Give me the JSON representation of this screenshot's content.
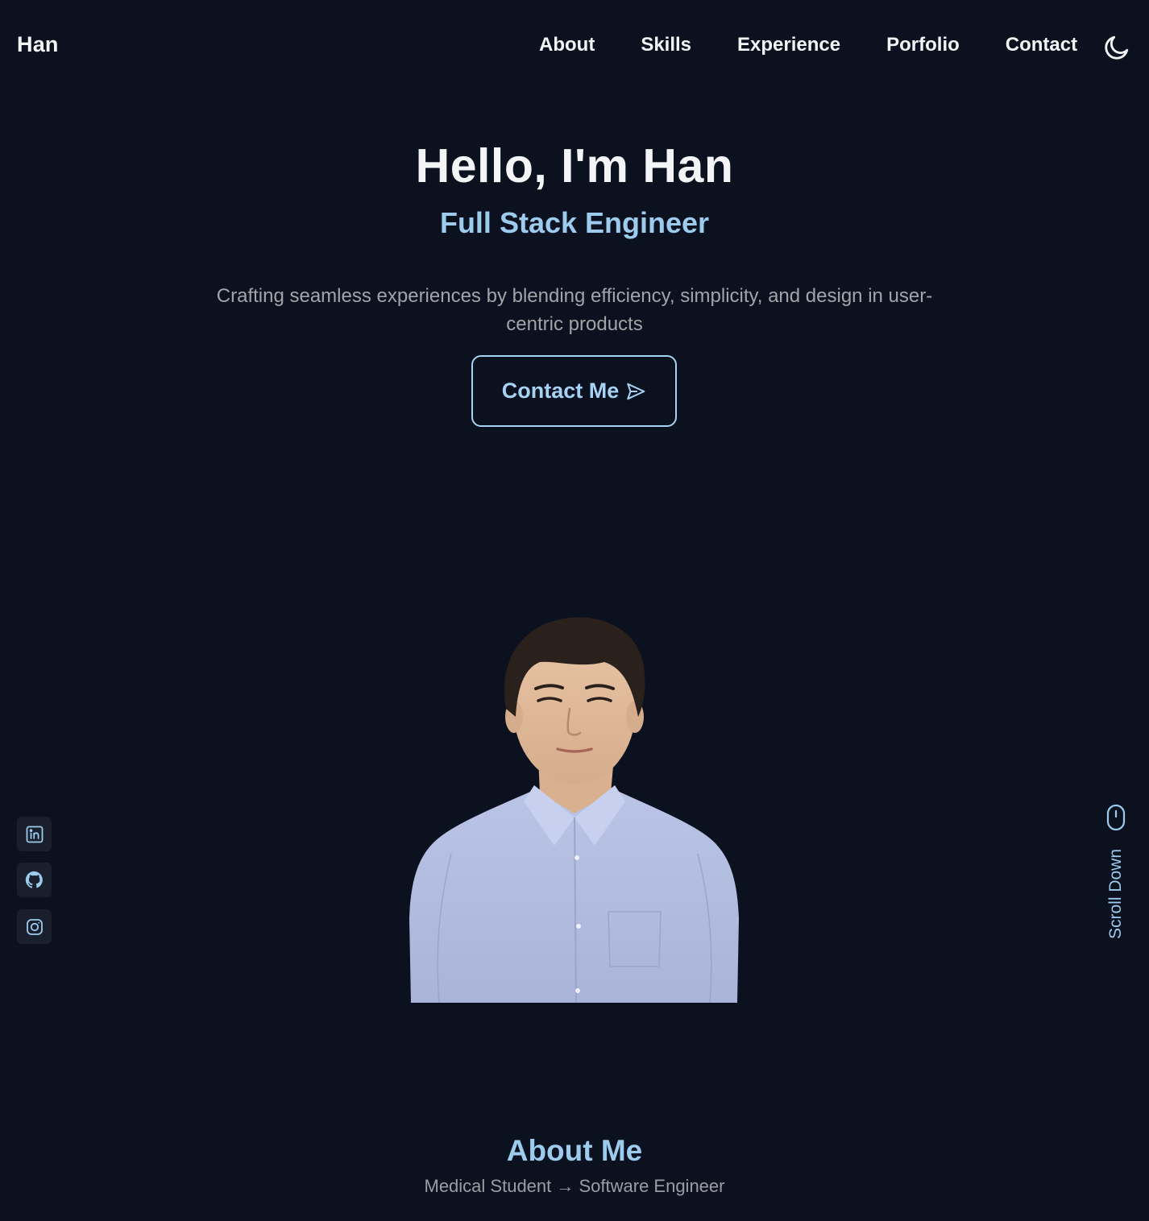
{
  "brand": "Han",
  "nav": {
    "items": [
      "About",
      "Skills",
      "Experience",
      "Porfolio",
      "Contact"
    ],
    "theme_icon": "moon-icon"
  },
  "hero": {
    "title": "Hello, I'm Han",
    "subtitle": "Full Stack Engineer",
    "description": "Crafting seamless experiences by blending efficiency, simplicity, and design in user-centric products",
    "cta_label": "Contact Me",
    "cta_icon": "send-icon"
  },
  "social": [
    {
      "icon": "linkedin-icon"
    },
    {
      "icon": "github-icon"
    },
    {
      "icon": "instagram-icon"
    }
  ],
  "scroll": {
    "label": "Scroll Down",
    "icon": "mouse-icon"
  },
  "about": {
    "title": "About Me",
    "subtitle": "Medical Student → Software Engineer"
  },
  "colors": {
    "background": "#0c1120",
    "accent": "#9ccbee",
    "text": "#f3f4f6",
    "muted": "#a3a3a8",
    "social_bg": "#1a1f2e"
  }
}
